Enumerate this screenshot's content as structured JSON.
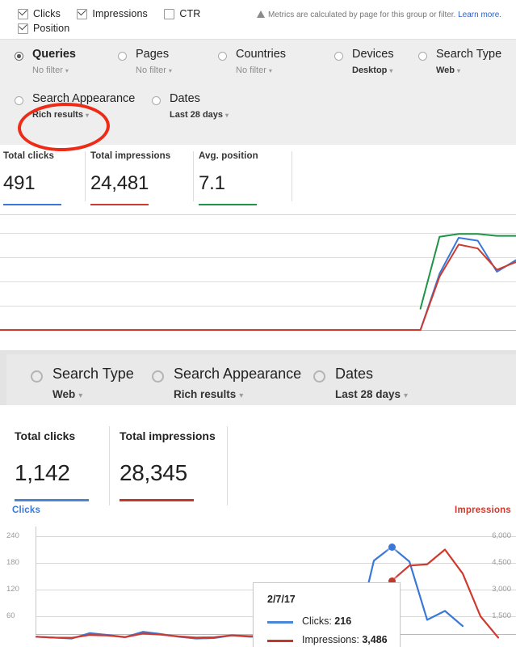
{
  "panel_one": {
    "metrics_checkboxes": [
      {
        "label": "Clicks",
        "checked": true
      },
      {
        "label": "Impressions",
        "checked": true
      },
      {
        "label": "CTR",
        "checked": false
      },
      {
        "label": "Position",
        "checked": true
      }
    ],
    "notice": {
      "icon": "warning-triangle-icon",
      "text": "Metrics are calculated by page for this group or filter. ",
      "link_text": "Learn more."
    },
    "filters": [
      {
        "name": "Queries",
        "value": "No filter",
        "selected": true,
        "value_strong": false
      },
      {
        "name": "Pages",
        "value": "No filter",
        "selected": false,
        "value_strong": false
      },
      {
        "name": "Countries",
        "value": "No filter",
        "selected": false,
        "value_strong": false
      },
      {
        "name": "Devices",
        "value": "Desktop",
        "selected": false,
        "value_strong": true
      },
      {
        "name": "Search Type",
        "value": "Web",
        "selected": false,
        "value_strong": true
      },
      {
        "name": "Search Appearance",
        "value": "Rich results",
        "selected": false,
        "value_strong": true
      },
      {
        "name": "Dates",
        "value": "Last 28 days",
        "selected": false,
        "value_strong": true
      }
    ],
    "annotation": {
      "shape": "red-ellipse",
      "target": "Rich results",
      "color": "#ed2b17"
    },
    "kpis": [
      {
        "title": "Total clicks",
        "value": "491",
        "color": "#3a78d8"
      },
      {
        "title": "Total impressions",
        "value": "24,481",
        "color": "#cf3a2e"
      },
      {
        "title": "Avg. position",
        "value": "7.1",
        "color": "#1d9447"
      }
    ]
  },
  "panel_two": {
    "filters": [
      {
        "name": "Search Type",
        "value": "Web",
        "selected": false
      },
      {
        "name": "Search Appearance",
        "value": "Rich results",
        "selected": false
      },
      {
        "name": "Dates",
        "value": "Last 28 days",
        "selected": false
      }
    ],
    "kpis": [
      {
        "title": "Total clicks",
        "value": "1,142",
        "color": "#4a86d8"
      },
      {
        "title": "Total impressions",
        "value": "28,345",
        "color": "#c0392b"
      }
    ],
    "tooltip": {
      "date": "2/7/17",
      "rows": [
        {
          "label": "Clicks:",
          "value": "216",
          "color": "#4a86d8"
        },
        {
          "label": "Impressions:",
          "value": "3,486",
          "color": "#c0392b"
        }
      ]
    }
  },
  "chart_data": [
    {
      "type": "line",
      "title": "",
      "xlabel": "",
      "ylabel": "",
      "grid": true,
      "legend": "none",
      "x": [
        1,
        2,
        3,
        4,
        5,
        6,
        7,
        8,
        9,
        10,
        11,
        12,
        13,
        14,
        15,
        16,
        17,
        18,
        19,
        20,
        21,
        22,
        23,
        24,
        25,
        26,
        27,
        28
      ],
      "series": [
        {
          "name": "Clicks",
          "color": "#3a78d8",
          "values": [
            0,
            0,
            0,
            0,
            0,
            0,
            0,
            0,
            0,
            0,
            0,
            0,
            0,
            0,
            0,
            0,
            0,
            0,
            0,
            0,
            0,
            0,
            0,
            58,
            95,
            92,
            60,
            72
          ]
        },
        {
          "name": "Impressions",
          "color": "#cf3a2e",
          "values": [
            0,
            0,
            0,
            0,
            0,
            0,
            0,
            0,
            0,
            0,
            0,
            0,
            0,
            0,
            0,
            0,
            0,
            0,
            0,
            0,
            0,
            0,
            0,
            55,
            88,
            84,
            62,
            70
          ]
        },
        {
          "name": "Position",
          "color": "#1d9447",
          "values": [
            null,
            null,
            null,
            null,
            null,
            null,
            null,
            null,
            null,
            null,
            null,
            null,
            null,
            null,
            null,
            null,
            null,
            null,
            null,
            null,
            null,
            null,
            22,
            96,
            99,
            99,
            97,
            97
          ]
        }
      ],
      "ylim": [
        0,
        100
      ],
      "note": "Flat at zero for first ~80% of range, then sharp spike"
    },
    {
      "type": "line",
      "title": "",
      "xlabel": "",
      "left_axis": {
        "label": "Clicks",
        "color": "#3a78d8",
        "ticks": [
          "240",
          "180",
          "120",
          "60"
        ],
        "ylim": [
          0,
          270
        ]
      },
      "right_axis": {
        "label": "Impressions",
        "color": "#cf3a2e",
        "ticks": [
          "6,000",
          "4,500",
          "3,000",
          "1,500"
        ],
        "ylim": [
          0,
          6750
        ]
      },
      "grid": true,
      "legend": "none",
      "x": [
        "1",
        "2",
        "3",
        "4",
        "5",
        "6",
        "7",
        "8",
        "9",
        "10",
        "11",
        "12",
        "13",
        "14",
        "15",
        "16",
        "17",
        "18",
        "19",
        "20",
        "21",
        "22",
        "23",
        "24",
        "25",
        "26",
        "27",
        "28"
      ],
      "series": [
        {
          "name": "Clicks",
          "color": "#3a78d8",
          "axis": "left",
          "values": [
            14,
            12,
            10,
            22,
            18,
            13,
            25,
            20,
            14,
            10,
            11,
            17,
            14,
            14,
            34,
            26,
            15,
            14,
            17,
            185,
            216,
            183,
            52,
            72,
            38,
            null,
            null,
            null
          ]
        },
        {
          "name": "Impressions",
          "color": "#cf3a2e",
          "axis": "right",
          "values": [
            350,
            300,
            290,
            450,
            420,
            330,
            530,
            470,
            370,
            300,
            320,
            430,
            380,
            400,
            870,
            740,
            480,
            430,
            400,
            1700,
            3486,
            4350,
            4420,
            5250,
            3900,
            1500,
            300,
            null
          ]
        }
      ],
      "highlight_point": {
        "date": "2/7/17",
        "clicks": 216,
        "impressions": 3486
      }
    }
  ]
}
